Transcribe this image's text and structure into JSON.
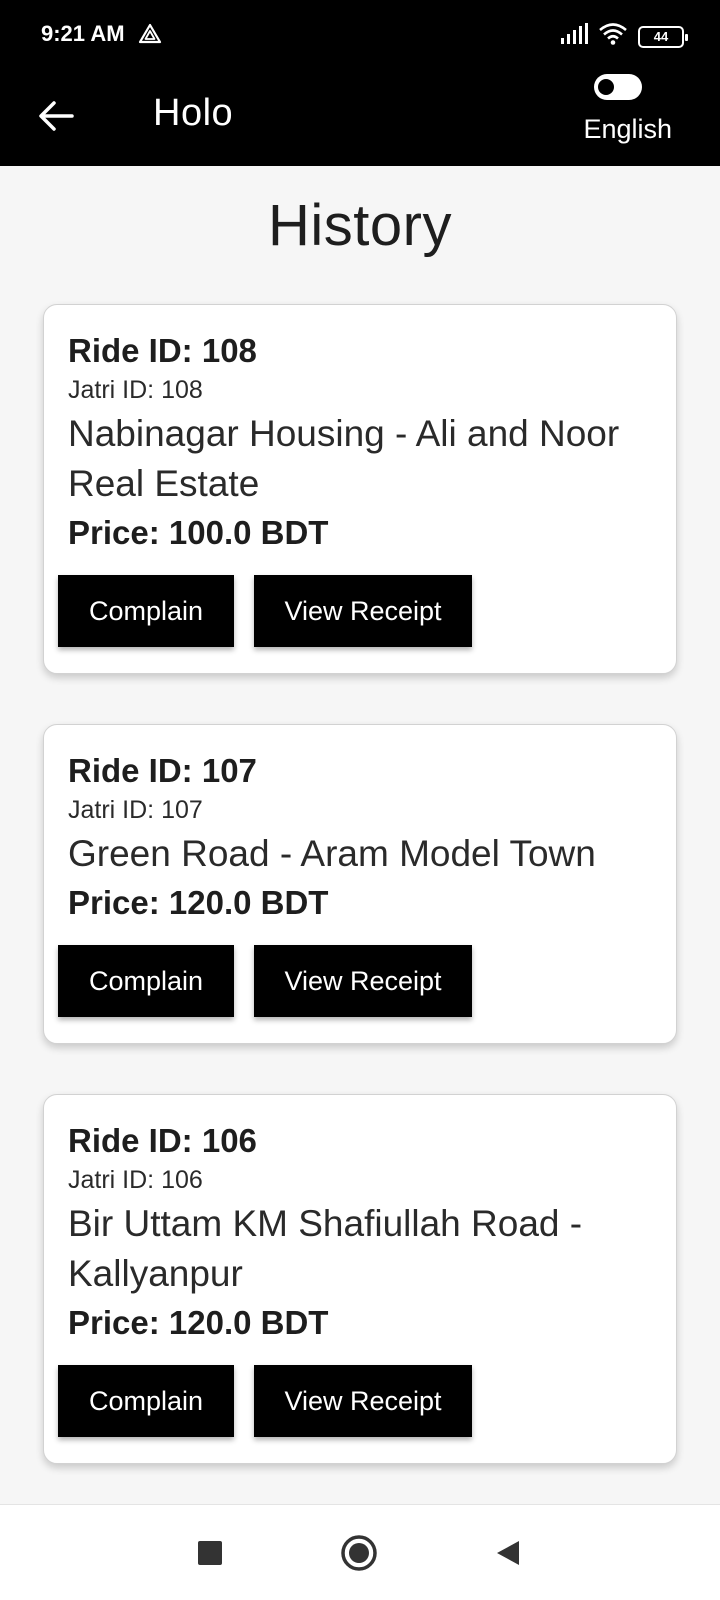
{
  "status_bar": {
    "time": "9:21 AM",
    "battery": "44"
  },
  "app_bar": {
    "title": "Holo",
    "language": "English"
  },
  "page": {
    "title": "History"
  },
  "rides": [
    {
      "ride_id": "Ride ID: 108",
      "jatri_id": "Jatri ID: 108",
      "route": "Nabinagar Housing - Ali and Noor Real Estate",
      "price": "Price: 100.0 BDT",
      "complain_label": "Complain",
      "receipt_label": "View Receipt"
    },
    {
      "ride_id": "Ride ID: 107",
      "jatri_id": "Jatri ID: 107",
      "route": "Green Road - Aram Model Town",
      "price": "Price: 120.0 BDT",
      "complain_label": "Complain",
      "receipt_label": "View Receipt"
    },
    {
      "ride_id": "Ride ID: 106",
      "jatri_id": "Jatri ID: 106",
      "route": "Bir Uttam KM Shafiullah Road - Kallyanpur",
      "price": "Price: 120.0 BDT",
      "complain_label": "Complain",
      "receipt_label": "View Receipt"
    }
  ],
  "icons": {
    "back": "arrow-left-icon",
    "alert": "alert-triangle-icon",
    "signal": "signal-icon",
    "wifi": "wifi-icon",
    "nav_recents": "square-icon",
    "nav_home": "circle-icon",
    "nav_back": "triangle-back-icon"
  }
}
